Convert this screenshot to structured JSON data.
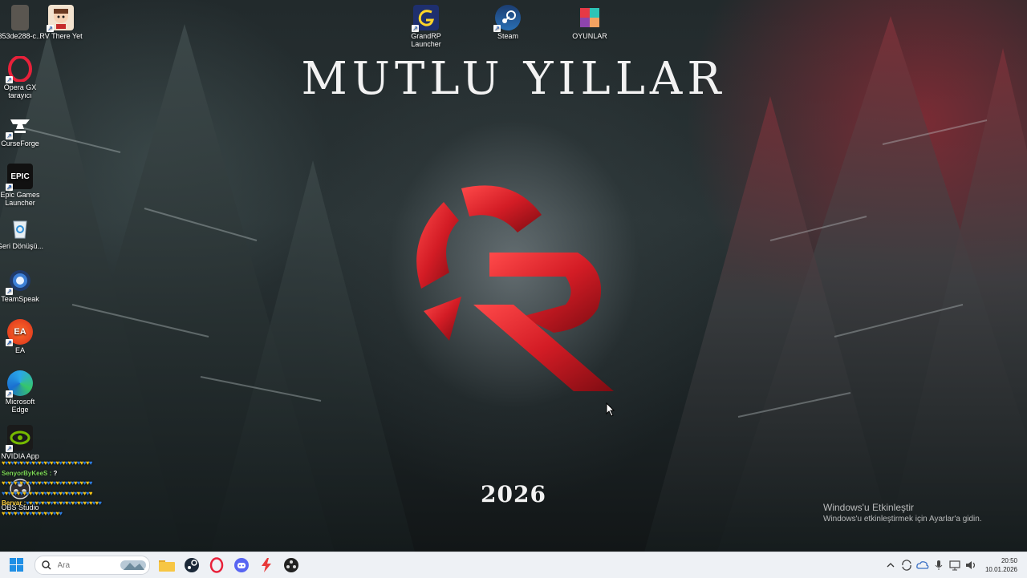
{
  "wallpaper": {
    "greeting": "MUTLU YILLAR",
    "year": "2026",
    "logo_color": "#d8202a"
  },
  "desktop_icons": [
    {
      "name": "file-353de288",
      "label": "353de288-c...",
      "icon": "image-file-icon"
    },
    {
      "name": "rv-there-yet",
      "label": "RV There Yet",
      "icon": "rv-there-yet-game-icon"
    },
    {
      "name": "opera-gx",
      "label": "Opera GX tarayıcı",
      "icon": "opera-gx-icon"
    },
    {
      "name": "curseforge",
      "label": "CurseForge",
      "icon": "curseforge-icon"
    },
    {
      "name": "epic-games",
      "label": "Epic Games Launcher",
      "icon": "epic-games-icon"
    },
    {
      "name": "recycle-bin",
      "label": "Geri Dönüşü...",
      "icon": "recycle-bin-icon"
    },
    {
      "name": "teamspeak",
      "label": "TeamSpeak",
      "icon": "teamspeak-icon"
    },
    {
      "name": "ea",
      "label": "EA",
      "icon": "ea-icon"
    },
    {
      "name": "microsoft-edge",
      "label": "Microsoft Edge",
      "icon": "edge-icon"
    },
    {
      "name": "nvidia-app",
      "label": "NVIDIA App",
      "icon": "nvidia-icon"
    },
    {
      "name": "obs-studio",
      "label": "OBS Studio",
      "icon": "obs-icon"
    },
    {
      "name": "grandrp-launcher",
      "label": "GrandRP Launcher",
      "icon": "grandrp-icon"
    },
    {
      "name": "steam",
      "label": "Steam",
      "icon": "steam-icon"
    },
    {
      "name": "oyunlar",
      "label": "OYUNLAR",
      "icon": "folder-games-icon"
    }
  ],
  "chat_overlay": {
    "lines": [
      {
        "user": "",
        "text": ""
      },
      {
        "user": "SenyorByKeeS :",
        "text": " ?"
      },
      {
        "user": "",
        "text": ""
      },
      {
        "user": "",
        "text": ""
      },
      {
        "user": "Bervar :",
        "text": ""
      },
      {
        "user": "",
        "text": ""
      }
    ]
  },
  "activation": {
    "title": "Windows'u Etkinleştir",
    "subtitle": "Windows'u etkinleştirmek için Ayarlar'a gidin."
  },
  "taskbar": {
    "search_placeholder": "Ara",
    "apps": [
      "start-icon",
      "file-explorer-icon",
      "steam-icon",
      "opera-gx-icon",
      "discord-icon",
      "bolt-app-icon",
      "obs-icon"
    ]
  },
  "tray": {
    "time": "20:50",
    "date": "10.01.2026"
  }
}
